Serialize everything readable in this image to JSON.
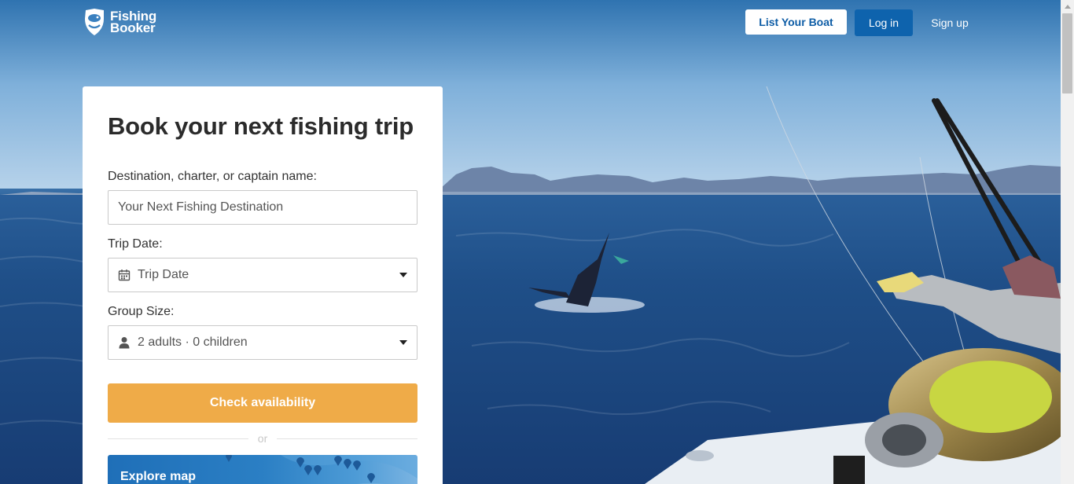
{
  "brand": {
    "line1": "Fishing",
    "line2": "Booker"
  },
  "header": {
    "list_boat": "List Your Boat",
    "login": "Log in",
    "signup": "Sign up"
  },
  "search_card": {
    "title": "Book your next fishing trip",
    "destination_label": "Destination, charter, or captain name:",
    "destination_placeholder": "Your Next Fishing Destination",
    "date_label": "Trip Date:",
    "date_value": "Trip Date",
    "group_label": "Group Size:",
    "group_value": "2 adults · 0 children",
    "check_button": "Check availability",
    "or_text": "or",
    "explore_map": "Explore map"
  },
  "colors": {
    "accent": "#efab48",
    "brand_blue": "#0e63ad"
  }
}
